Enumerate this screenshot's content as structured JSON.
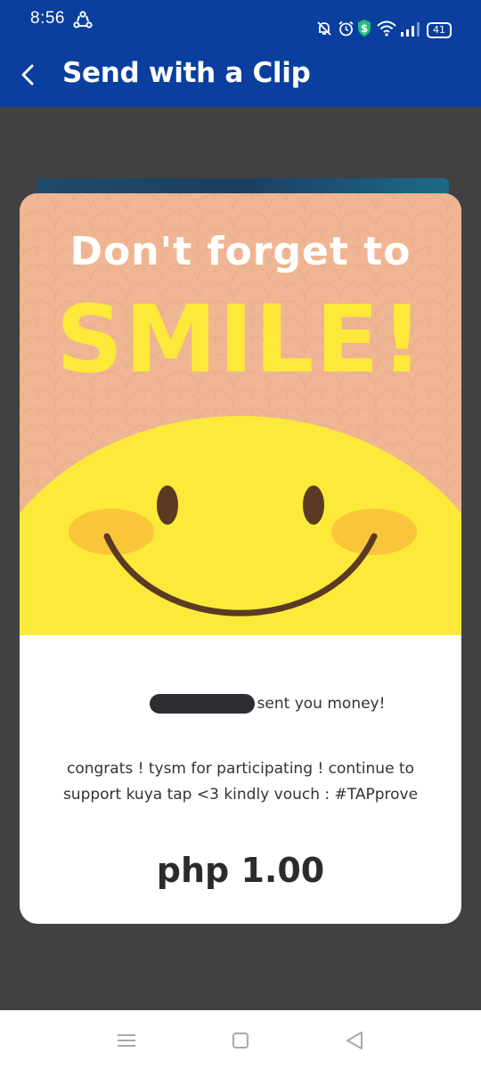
{
  "status_bar": {
    "time": "8:56",
    "battery": "41",
    "icons": [
      "app-sync-icon",
      "mute-bell-icon",
      "alarm-icon",
      "shield-dollar-icon",
      "wifi-icon",
      "signal-icon",
      "battery-icon"
    ]
  },
  "app_bar": {
    "title": "Send with a Clip",
    "back_icon": "chevron-left-icon",
    "color": "#0a3f9f"
  },
  "clip": {
    "headline_top": "Don't forget to",
    "headline_main": "SMILE!",
    "sender_suffix": "sent you money!",
    "message_line1": "congrats ! tysm for participating ! continue to",
    "message_line2": "support kuya tap <3 kindly vouch : #TAPprove",
    "amount": "php 1.00",
    "colors": {
      "peach": "#f0b593",
      "yellow": "#fde93a",
      "blush": "#f9c53a",
      "brown": "#5b3a23"
    }
  },
  "nav": {
    "icons": [
      "menu-icon",
      "home-square-icon",
      "back-triangle-icon"
    ]
  }
}
